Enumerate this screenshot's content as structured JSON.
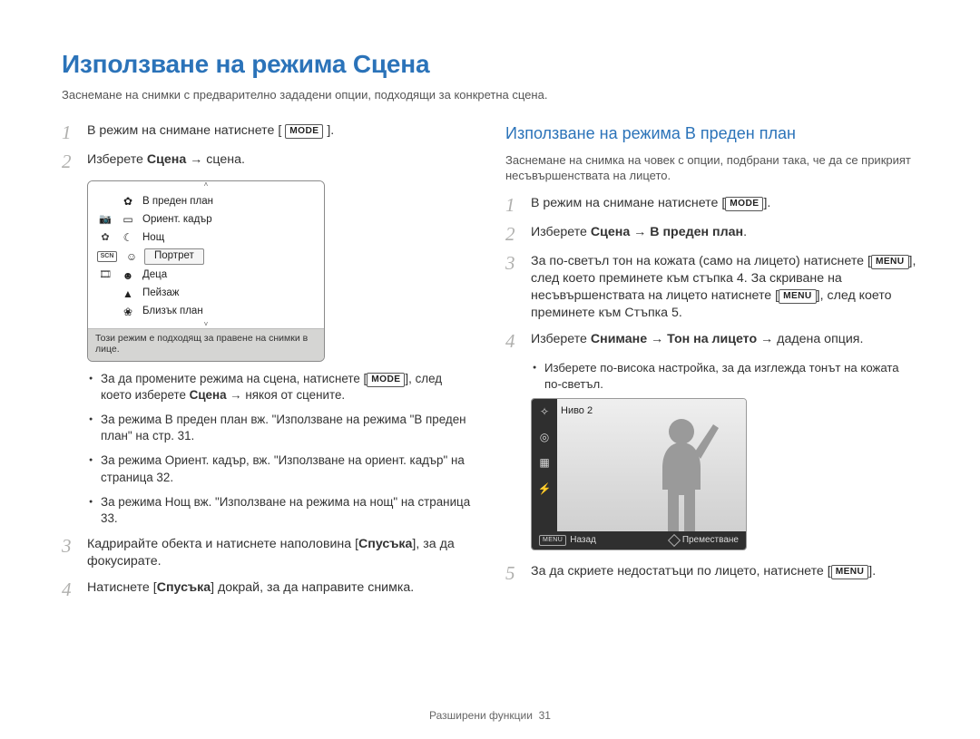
{
  "title": "Използване на режима Сцена",
  "intro": "Заснемане на снимки с предварително зададени опции, подходящи за конкретна сцена.",
  "left": {
    "step1_pre": "В режим на снимане натиснете [",
    "step1_post": "].",
    "mode_label": "MODE",
    "step2_pre": "Изберете ",
    "step2_bold": "Сцена",
    "step2_mid": " → сцена.",
    "scene_menu": {
      "items": [
        {
          "icon": "✿",
          "label": "В преден план"
        },
        {
          "icon": "⌂",
          "label": "Ориент. кадър"
        },
        {
          "icon": "☾",
          "label": "Нощ"
        },
        {
          "icon": "☺",
          "label": "Портрет",
          "highlight": true
        },
        {
          "icon": "👶",
          "label": "Деца"
        },
        {
          "icon": "▲",
          "label": "Пейзаж"
        },
        {
          "icon": "❀",
          "label": "Близък план"
        }
      ],
      "side_scn": "SCN",
      "footer": "Този режим е подходящ за правене на снимки в лице."
    },
    "bullets": [
      {
        "pre": "За да промените режима на сцена, натиснете [",
        "post": "], след което изберете ",
        "b": "Сцена",
        "tail": " → някоя от сцените."
      },
      {
        "text": "За режима В преден план вж. \"Използване на режима \"В преден план\" на стр. 31."
      },
      {
        "text": "За режима Ориент. кадър, вж. \"Използване на ориент. кадър\" на страница 32."
      },
      {
        "text": "За режима Нощ вж. \"Използване на режима на нощ\" на страница 33."
      }
    ],
    "step3_pre": "Кадрирайте обекта и натиснете наполовина [",
    "step3_b": "Спусъка",
    "step3_post": "], за да фокусирате.",
    "step4_pre": "Натиснете [",
    "step4_b": "Спусъка",
    "step4_post": "] докрай, за да направите снимка."
  },
  "right": {
    "subhead": "Използване на режима В преден план",
    "intro": "Заснемане на снимка на човек с опции, подбрани така, че да се прикрият несъвършенствата на лицето.",
    "step1_pre": "В режим на снимане натиснете [",
    "step1_post": "].",
    "step2_pre": "Изберете ",
    "step2_b1": "Сцена",
    "step2_mid": " → ",
    "step2_b2": "В преден план",
    "step2_post": ".",
    "step3_a": "За по-светъл тон на кожата (само на лицето) натиснете [",
    "step3_b": "], след което преминете към стъпка 4. За скриване на несъвършенствата на лицето натиснете [",
    "step3_c": "], след което преминете към Стъпка 5.",
    "menu_label": "MENU",
    "step4_pre": "Изберете ",
    "step4_b1": "Снимане",
    "step4_mid1": " → ",
    "step4_b2": "Тон на лицето",
    "step4_mid2": " → дадена опция.",
    "sub4": "Изберете по-висока настройка, за да изглежда тонът на кожата по-светъл.",
    "preview": {
      "level": "Ниво 2",
      "back": "Назад",
      "move": "Преместване",
      "menu": "MENU"
    },
    "step5_pre": "За да скриете недостатъци по лицето, натиснете [",
    "step5_post": "]."
  },
  "footer_section": "Разширени функции",
  "footer_page": "31"
}
